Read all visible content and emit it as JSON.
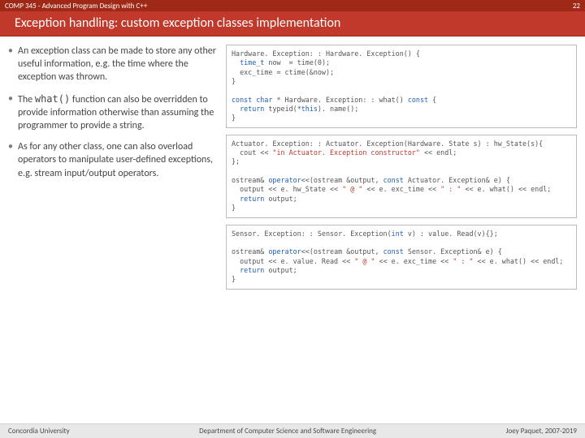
{
  "header": {
    "course": "COMP 345 - Advanced Program Design with C++",
    "page_number": "22"
  },
  "title": "Exception handling: custom exception classes implementation",
  "bullets": [
    {
      "text": "An exception class can be made to store any other useful information, e.g. the time where the exception was thrown."
    },
    {
      "text_pre": "The ",
      "code": "what()",
      "text_post": " function can also be overridden to provide information otherwise than assuming the programmer to provide a string."
    },
    {
      "text": "As for any other class, one can also overload operators to manipulate user-defined exceptions, e.g. stream input/output operators."
    }
  ],
  "code_blocks": [
    {
      "html": "Hardware. Exception: : Hardware. Exception() {\n  <span class=\"kw\">time_t</span> now  = time(0);\n  exc_time = ctime(&now);\n}\n\n<span class=\"kw\">const char</span> * Hardware. Exception: : what() <span class=\"kw\">const</span> {\n  <span class=\"kw\">return</span> typeid(*<span class=\"kw\">this</span>). name();\n}"
    },
    {
      "html": "Actuator. Exception: : Actuator. Exception(Hardware. State s) : hw_State(s){\n  cout << <span class=\"str\">\"in Actuator. Exception constructor\"</span> << endl;\n};\n\nostream& <span class=\"kw\">operator</span><<(ostream &output, <span class=\"kw\">const</span> Actuator. Exception& e) {\n  output << e. hw_State << <span class=\"str\">\" @ \"</span> << e. exc_time << <span class=\"str\">\" : \"</span> << e. what() << endl;\n  <span class=\"kw\">return</span> output;\n}"
    },
    {
      "html": "Sensor. Exception: : Sensor. Exception(<span class=\"kw\">int</span> v) : value. Read(v){};\n\nostream& <span class=\"kw\">operator</span><<(ostream &output, <span class=\"kw\">const</span> Sensor. Exception& e) {\n  output << e. value. Read << <span class=\"str\">\" @ \"</span> << e. exc_time << <span class=\"str\">\" : \"</span> << e. what() << endl;\n  <span class=\"kw\">return</span> output;\n}"
    }
  ],
  "footer": {
    "left": "Concordia University",
    "center": "Department of Computer Science and Software Engineering",
    "right": "Joey Paquet, 2007-2019"
  }
}
